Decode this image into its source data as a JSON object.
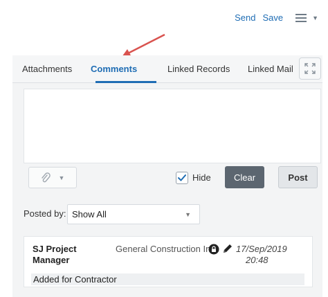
{
  "toolbar": {
    "send_label": "Send",
    "save_label": "Save",
    "menu_icon": "hamburger-icon",
    "menu_caret_icon": "chevron-down-icon"
  },
  "tabs": [
    {
      "label": "Attachments",
      "active": false
    },
    {
      "label": "Comments",
      "active": true
    },
    {
      "label": "Linked Records",
      "active": false
    },
    {
      "label": "Linked Mail",
      "active": false
    }
  ],
  "expand_icon": "expand-icon",
  "comment_box": {
    "value": "",
    "attach_icon": "paperclip-icon",
    "hide_label": "Hide",
    "hide_checked": true,
    "clear_label": "Clear",
    "post_label": "Post"
  },
  "filter": {
    "label": "Posted by:",
    "selected": "Show All"
  },
  "comments": [
    {
      "author": "SJ Project Manager",
      "company": "General Construction Inc",
      "date": "17/Sep/2019",
      "time": "20:48",
      "text": "Added for Contractor"
    }
  ],
  "colors": {
    "accent": "#1f6db4",
    "annotation_arrow": "#d9534f",
    "clear_button": "#5c6670"
  }
}
